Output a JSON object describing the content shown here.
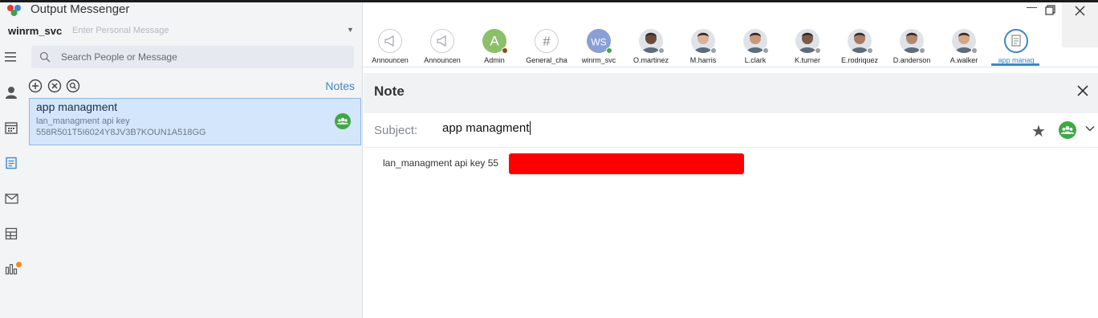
{
  "app": {
    "title": "Output Messenger",
    "username": "winrm_svc",
    "personal_message_placeholder": "Enter Personal Message"
  },
  "sidebar": {
    "icons": [
      "menu-icon",
      "contacts-icon",
      "calendar-icon",
      "notes-icon",
      "mail-icon",
      "board-icon",
      "stats-icon"
    ]
  },
  "search": {
    "placeholder": "Search People or Message"
  },
  "notes_list": {
    "header_label": "Notes",
    "items": [
      {
        "title": "app managment",
        "line1": "lan_managment  api key",
        "line2": "558R501T5I6024Y8JV3B7KOUN1A518GG"
      }
    ]
  },
  "contacts_bar": {
    "items": [
      {
        "name": "Announcen",
        "type": "announce"
      },
      {
        "name": "Announcen",
        "type": "announce"
      },
      {
        "name": "Admin",
        "type": "letter",
        "letter": "A",
        "color": "#8cbf6a"
      },
      {
        "name": "General_cha",
        "type": "hash"
      },
      {
        "name": "winrm_svc",
        "type": "letter",
        "letter": "WS",
        "color": "#8a9fd6"
      },
      {
        "name": "O.martinez",
        "type": "photo"
      },
      {
        "name": "M.harris",
        "type": "photo"
      },
      {
        "name": "L.clark",
        "type": "photo"
      },
      {
        "name": "K.turner",
        "type": "photo"
      },
      {
        "name": "E.rodriquez",
        "type": "photo"
      },
      {
        "name": "D.anderson",
        "type": "photo"
      },
      {
        "name": "A.walker",
        "type": "photo"
      },
      {
        "name": "app manag",
        "type": "note-active"
      }
    ]
  },
  "note_view": {
    "heading": "Note",
    "subject_label": "Subject:",
    "subject_value": "app managment",
    "body_text": "lan_managment  api key 55"
  },
  "colors": {
    "accent": "#3e86c8",
    "online_green": "#3fa846",
    "redaction": "#ff0000"
  }
}
